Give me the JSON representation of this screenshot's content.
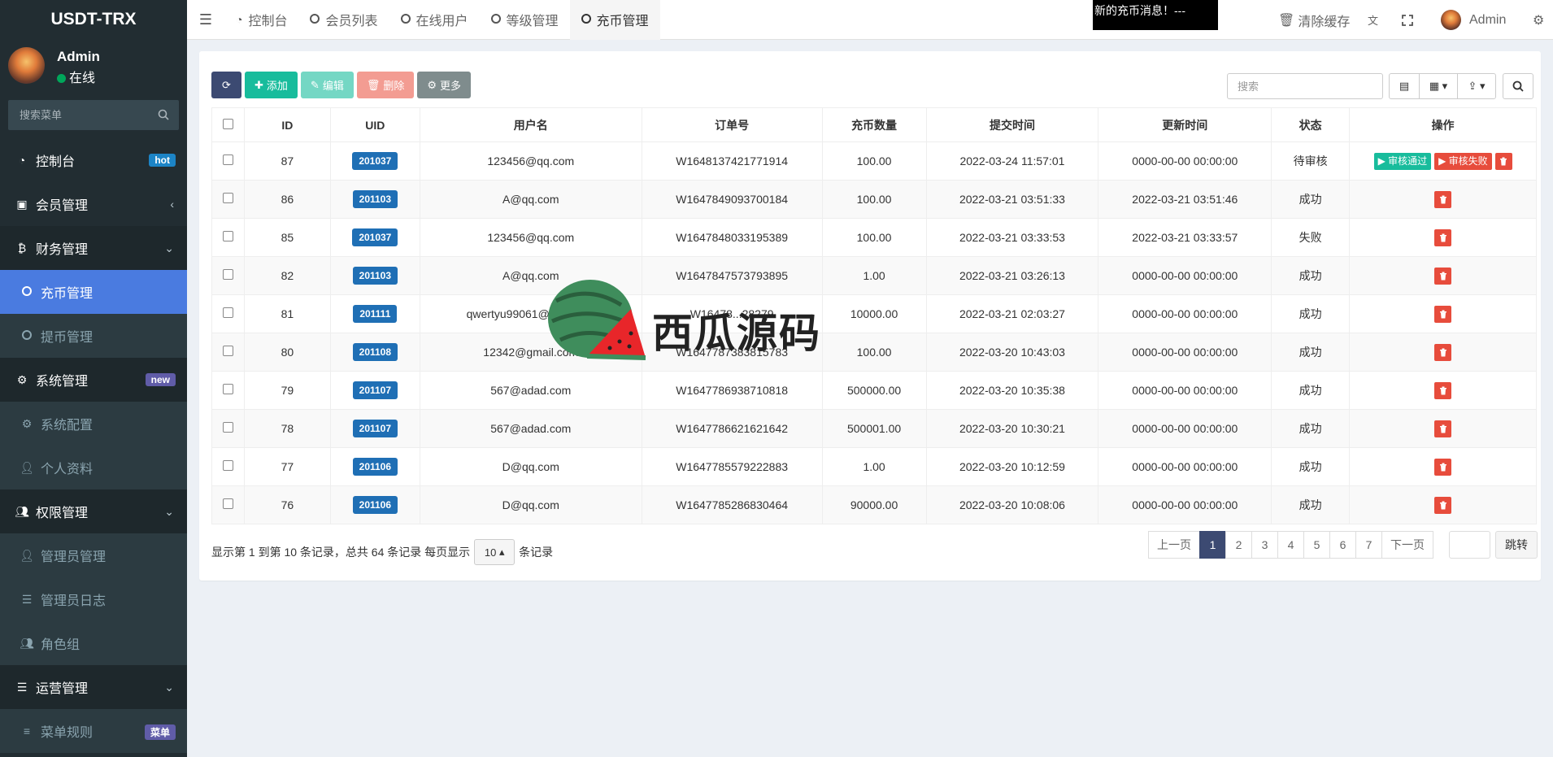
{
  "app": {
    "title": "USDT-TRX"
  },
  "user": {
    "name": "Admin",
    "status": "在线"
  },
  "sidebar": {
    "search_placeholder": "搜索菜单",
    "items": [
      {
        "label": "控制台",
        "badge": "hot",
        "badge_color": "#1c84c6"
      },
      {
        "label": "会员管理"
      },
      {
        "label": "财务管理"
      },
      {
        "label": "充币管理"
      },
      {
        "label": "提币管理"
      },
      {
        "label": "系统管理",
        "badge": "new",
        "badge_color": "#605ca8"
      },
      {
        "label": "系统配置"
      },
      {
        "label": "个人资料"
      },
      {
        "label": "权限管理"
      },
      {
        "label": "管理员管理"
      },
      {
        "label": "管理员日志"
      },
      {
        "label": "角色组"
      },
      {
        "label": "运营管理"
      },
      {
        "label": "菜单规则",
        "badge": "菜单",
        "badge_color": "#605ca8"
      }
    ]
  },
  "topbar": {
    "tabs": [
      "控制台",
      "会员列表",
      "在线用户",
      "等级管理",
      "充币管理"
    ],
    "notice": "新的充币消息！---",
    "clear_cache": "清除缓存",
    "user": "Admin"
  },
  "toolbar": {
    "add": "添加",
    "edit": "编辑",
    "delete": "删除",
    "more": "更多",
    "search_placeholder": "搜索"
  },
  "table": {
    "headers": [
      "ID",
      "UID",
      "用户名",
      "订单号",
      "充币数量",
      "提交时间",
      "更新时间",
      "状态",
      "操作"
    ],
    "rows": [
      {
        "id": "87",
        "uid": "201037",
        "user": "123456@qq.com",
        "order": "W1648137421771914",
        "amount": "100.00",
        "submit": "2022-03-24 11:57:01",
        "update": "0000-00-00 00:00:00",
        "status": "待审核",
        "status_type": "wait"
      },
      {
        "id": "86",
        "uid": "201103",
        "user": "A@qq.com",
        "order": "W1647849093700184",
        "amount": "100.00",
        "submit": "2022-03-21 03:51:33",
        "update": "2022-03-21 03:51:46",
        "status": "成功",
        "status_type": "ok"
      },
      {
        "id": "85",
        "uid": "201037",
        "user": "123456@qq.com",
        "order": "W1647848033195389",
        "amount": "100.00",
        "submit": "2022-03-21 03:33:53",
        "update": "2022-03-21 03:33:57",
        "status": "失败",
        "status_type": "fail"
      },
      {
        "id": "82",
        "uid": "201103",
        "user": "A@qq.com",
        "order": "W1647847573793895",
        "amount": "1.00",
        "submit": "2022-03-21 03:26:13",
        "update": "0000-00-00 00:00:00",
        "status": "成功",
        "status_type": "ok"
      },
      {
        "id": "81",
        "uid": "201111",
        "user": "qwertyu99061@outlook.c",
        "order": "W16478...28279",
        "amount": "10000.00",
        "submit": "2022-03-21 02:03:27",
        "update": "0000-00-00 00:00:00",
        "status": "成功",
        "status_type": "ok"
      },
      {
        "id": "80",
        "uid": "201108",
        "user": "12342@gmail.com",
        "order": "W1647787383815783",
        "amount": "100.00",
        "submit": "2022-03-20 10:43:03",
        "update": "0000-00-00 00:00:00",
        "status": "成功",
        "status_type": "ok"
      },
      {
        "id": "79",
        "uid": "201107",
        "user": "567@adad.com",
        "order": "W1647786938710818",
        "amount": "500000.00",
        "submit": "2022-03-20 10:35:38",
        "update": "0000-00-00 00:00:00",
        "status": "成功",
        "status_type": "ok"
      },
      {
        "id": "78",
        "uid": "201107",
        "user": "567@adad.com",
        "order": "W1647786621621642",
        "amount": "500001.00",
        "submit": "2022-03-20 10:30:21",
        "update": "0000-00-00 00:00:00",
        "status": "成功",
        "status_type": "ok"
      },
      {
        "id": "77",
        "uid": "201106",
        "user": "D@qq.com",
        "order": "W1647785579222883",
        "amount": "1.00",
        "submit": "2022-03-20 10:12:59",
        "update": "0000-00-00 00:00:00",
        "status": "成功",
        "status_type": "ok"
      },
      {
        "id": "76",
        "uid": "201106",
        "user": "D@qq.com",
        "order": "W1647785286830464",
        "amount": "90000.00",
        "submit": "2022-03-20 10:08:06",
        "update": "0000-00-00 00:00:00",
        "status": "成功",
        "status_type": "ok"
      }
    ],
    "action_pass": "审核通过",
    "action_fail": "审核失败"
  },
  "footer": {
    "info_prefix": "显示第 1 到第 10 条记录，总共 64 条记录 每页显示",
    "page_size": "10",
    "info_suffix": "条记录",
    "prev": "上一页",
    "pages": [
      "1",
      "2",
      "3",
      "4",
      "5",
      "6",
      "7"
    ],
    "next": "下一页",
    "jump": "跳转"
  },
  "watermark": {
    "text": "西瓜源码"
  }
}
